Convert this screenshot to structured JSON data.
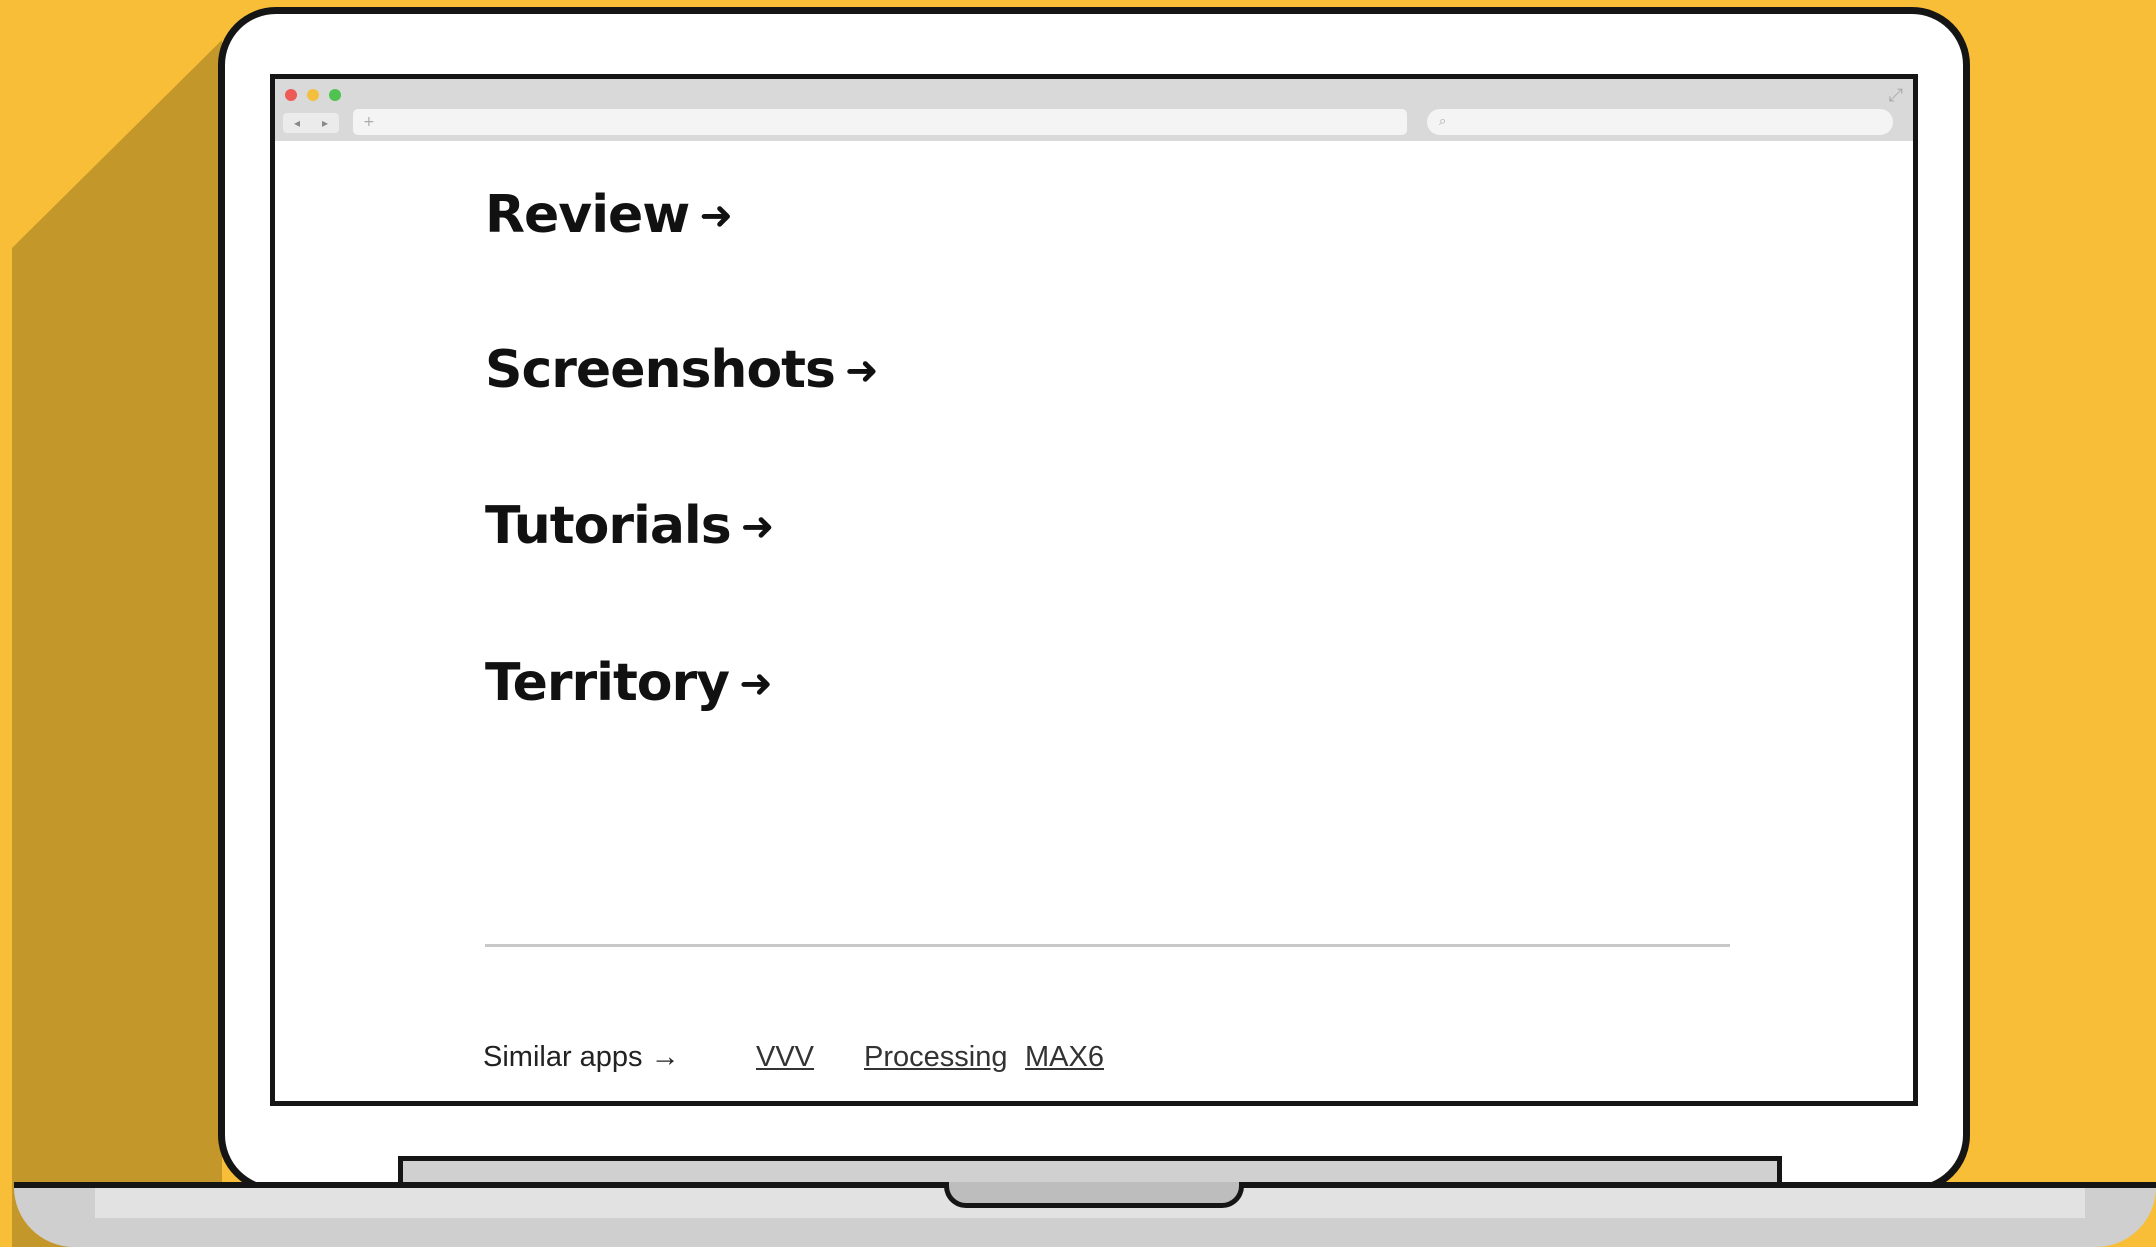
{
  "browser": {
    "nav_back": "◂",
    "nav_forward": "▸",
    "url_placeholder": "+",
    "search_placeholder": "⌕",
    "expand_icon": "⤢"
  },
  "sections": [
    {
      "label": "Review",
      "arrow": "➜"
    },
    {
      "label": "Screenshots",
      "arrow": "➜"
    },
    {
      "label": "Tutorials",
      "arrow": "➜"
    },
    {
      "label": "Territory",
      "arrow": "➜"
    }
  ],
  "similar": {
    "label": "Similar apps →",
    "links": [
      "VVV",
      "Processing",
      "MAX6"
    ]
  },
  "colors": {
    "background": "#F8BE37",
    "shadow": "#C4972B",
    "outline": "#151515"
  }
}
